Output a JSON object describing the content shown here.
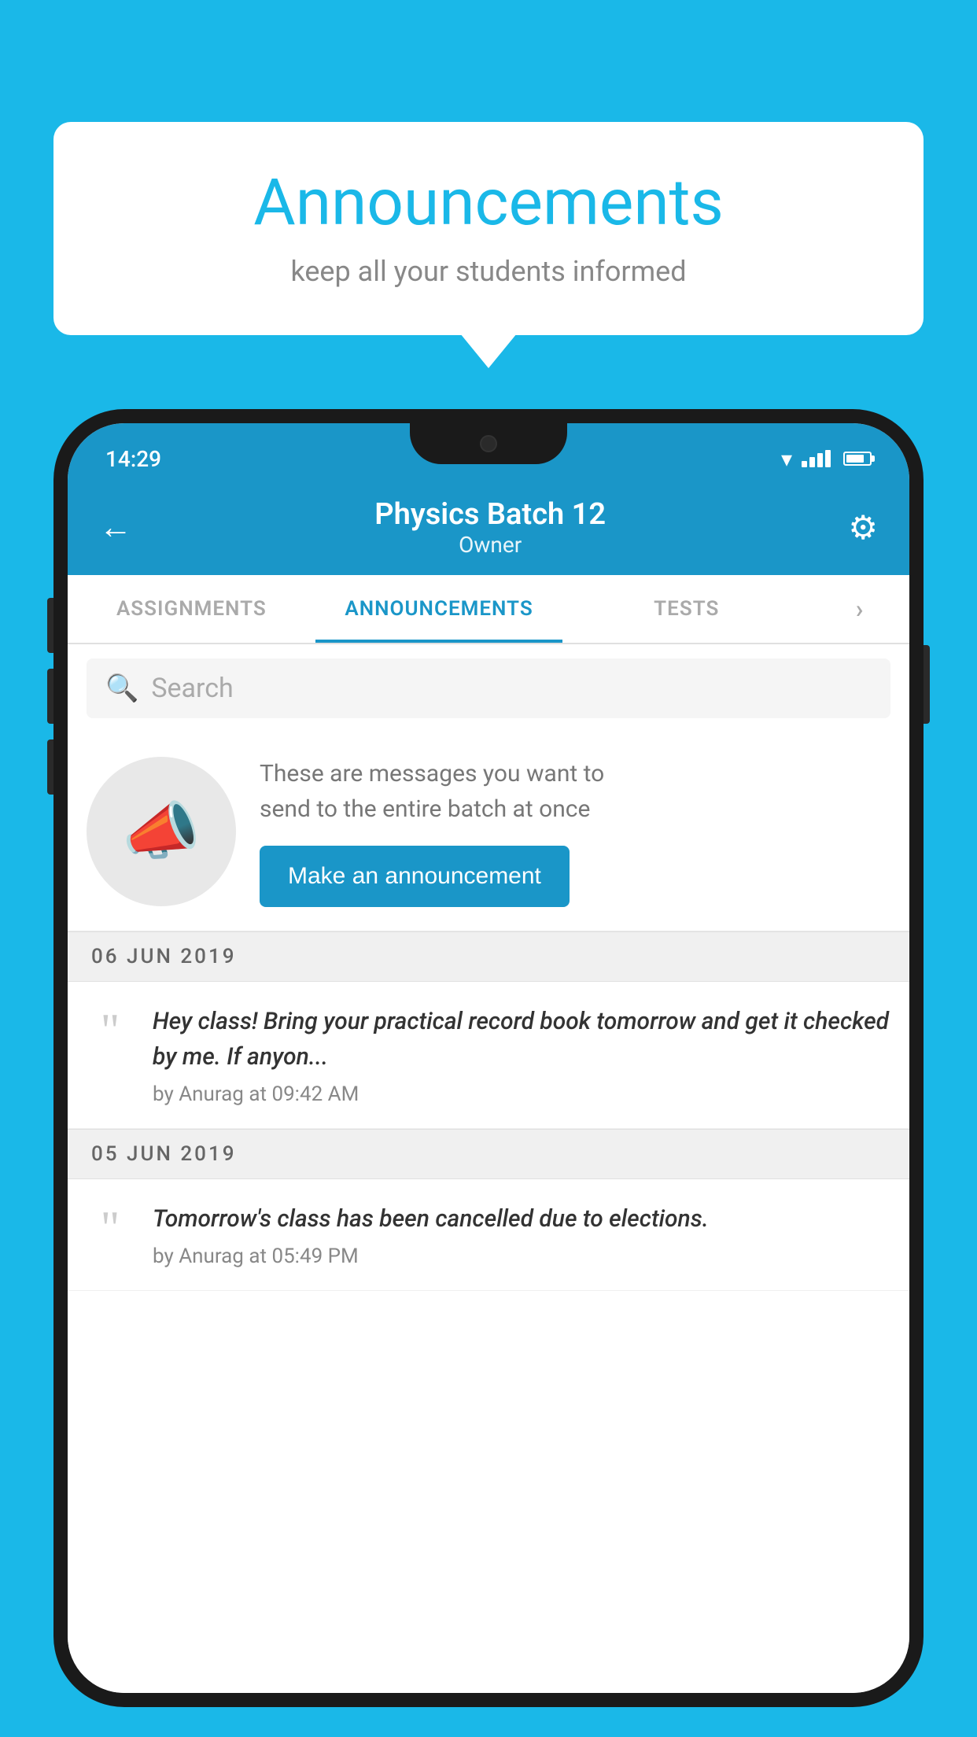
{
  "background_color": "#1ab8e8",
  "speech_bubble": {
    "title": "Announcements",
    "subtitle": "keep all your students informed"
  },
  "status_bar": {
    "time": "14:29"
  },
  "app_bar": {
    "title": "Physics Batch 12",
    "subtitle": "Owner",
    "back_label": "←"
  },
  "tabs": [
    {
      "label": "ASSIGNMENTS",
      "active": false
    },
    {
      "label": "ANNOUNCEMENTS",
      "active": true
    },
    {
      "label": "TESTS",
      "active": false
    },
    {
      "label": "···",
      "active": false
    }
  ],
  "search": {
    "placeholder": "Search"
  },
  "promo": {
    "description_line1": "These are messages you want to",
    "description_line2": "send to the entire batch at once",
    "button_label": "Make an announcement"
  },
  "announcements": [
    {
      "date": "06  JUN  2019",
      "text": "Hey class! Bring your practical record book tomorrow and get it checked by me. If anyon...",
      "meta": "by Anurag at 09:42 AM"
    },
    {
      "date": "05  JUN  2019",
      "text": "Tomorrow's class has been cancelled due to elections.",
      "meta": "by Anurag at 05:49 PM"
    }
  ]
}
